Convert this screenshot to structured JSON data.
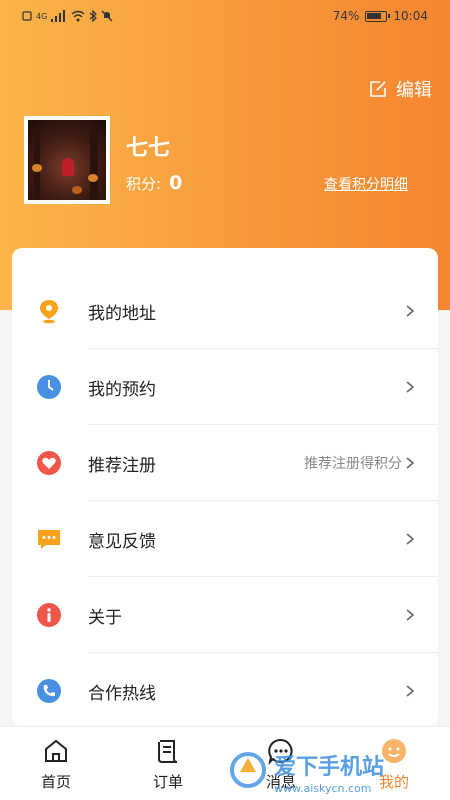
{
  "status_bar": {
    "battery": "74%",
    "time": "10:04",
    "network_badge": "4G"
  },
  "header": {
    "edit_label": "编辑",
    "user_name": "七七",
    "points_label": "积分:",
    "points_value": "0",
    "points_detail_link": "查看积分明细"
  },
  "menu": {
    "items": [
      {
        "label": "我的地址",
        "hint": "",
        "icon": "location-pin-icon",
        "color": "#f7a21b"
      },
      {
        "label": "我的预约",
        "hint": "",
        "icon": "clock-icon",
        "color": "#4a90e2"
      },
      {
        "label": "推荐注册",
        "hint": "推荐注册得积分",
        "icon": "heart-icon",
        "color": "#f0574a"
      },
      {
        "label": "意见反馈",
        "hint": "",
        "icon": "chat-bubble-icon",
        "color": "#f7a21b"
      },
      {
        "label": "关于",
        "hint": "",
        "icon": "info-icon",
        "color": "#f0574a"
      },
      {
        "label": "合作热线",
        "hint": "",
        "icon": "phone-icon",
        "color": "#4a90e2"
      }
    ]
  },
  "tabbar": {
    "tabs": [
      {
        "label": "首页",
        "icon": "home-icon",
        "active": false
      },
      {
        "label": "订单",
        "icon": "order-icon",
        "active": false
      },
      {
        "label": "消息",
        "icon": "message-icon",
        "active": false
      },
      {
        "label": "我的",
        "icon": "profile-icon",
        "active": true
      }
    ]
  },
  "colors": {
    "accent": "#f5862f",
    "header_start": "#fbb54a",
    "header_end": "#f5862f"
  },
  "watermark": {
    "text": "爱下手机站",
    "url": "www.aiskycn.com"
  }
}
